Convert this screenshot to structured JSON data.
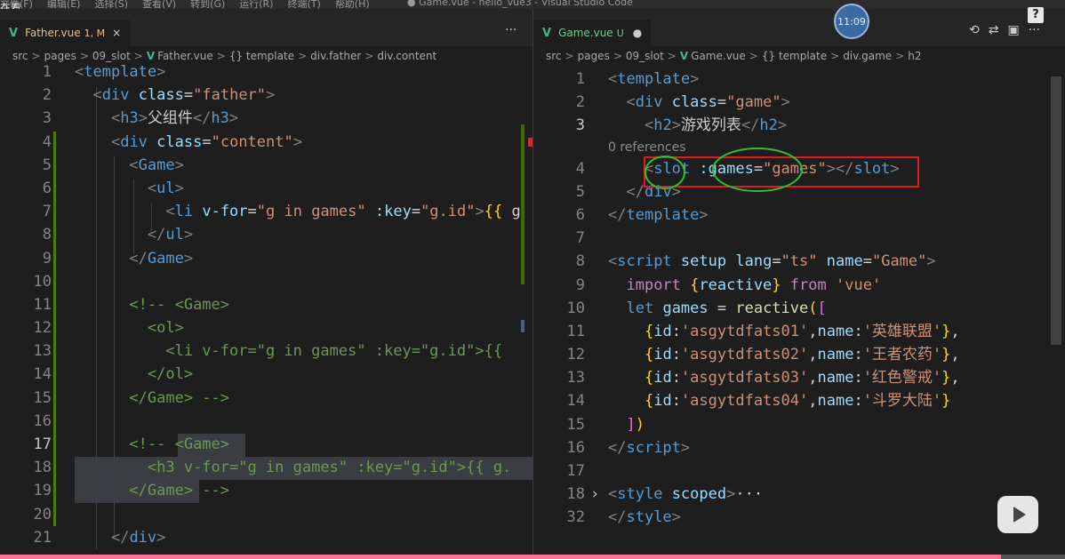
{
  "window": {
    "title": "● Game.vue - hello_vue3 - Visual Studio Code",
    "menu": [
      "文件(F)",
      "编辑(E)",
      "选择(S)",
      "查看(V)",
      "转到(G)",
      "运行(R)",
      "终端(T)",
      "帮助(H)"
    ],
    "overlay_text": "在看"
  },
  "left": {
    "tab": {
      "name": "Father.vue",
      "badge": "1, M",
      "close": "×",
      "more": "···"
    },
    "breadcrumb": [
      "src",
      "pages",
      "09_slot",
      "Father.vue",
      "{} template",
      "div.father",
      "div.content"
    ],
    "lines": [
      {
        "n": "1",
        "t": [
          [
            "tg",
            "<"
          ],
          [
            "tn",
            "template"
          ],
          [
            "tg",
            ">"
          ]
        ]
      },
      {
        "n": "2",
        "t": [
          [
            "pl",
            "  "
          ],
          [
            "tg",
            "<"
          ],
          [
            "tn",
            "div"
          ],
          [
            "pl",
            " "
          ],
          [
            "an",
            "class"
          ],
          [
            "pl",
            "="
          ],
          [
            "as",
            "\"father\""
          ],
          [
            "tg",
            ">"
          ]
        ]
      },
      {
        "n": "3",
        "t": [
          [
            "pl",
            "    "
          ],
          [
            "tg",
            "<"
          ],
          [
            "tn",
            "h3"
          ],
          [
            "tg",
            ">"
          ],
          [
            "ct",
            "父组件"
          ],
          [
            "tg",
            "</"
          ],
          [
            "tn",
            "h3"
          ],
          [
            "tg",
            ">"
          ]
        ]
      },
      {
        "n": "4",
        "t": [
          [
            "pl",
            "    "
          ],
          [
            "tg",
            "<"
          ],
          [
            "tn",
            "div"
          ],
          [
            "pl",
            " "
          ],
          [
            "an",
            "class"
          ],
          [
            "pl",
            "="
          ],
          [
            "as",
            "\"content\""
          ],
          [
            "tg",
            ">"
          ]
        ]
      },
      {
        "n": "5",
        "t": [
          [
            "pl",
            "      "
          ],
          [
            "tg",
            "<"
          ],
          [
            "tn",
            "Game"
          ],
          [
            "tg",
            ">"
          ]
        ]
      },
      {
        "n": "6",
        "t": [
          [
            "pl",
            "        "
          ],
          [
            "tg",
            "<"
          ],
          [
            "tn",
            "ul"
          ],
          [
            "tg",
            ">"
          ]
        ]
      },
      {
        "n": "7",
        "t": [
          [
            "pl",
            "          "
          ],
          [
            "tg",
            "<"
          ],
          [
            "tn",
            "li"
          ],
          [
            "pl",
            " "
          ],
          [
            "an",
            "v-for"
          ],
          [
            "pl",
            "="
          ],
          [
            "as",
            "\"g in games\""
          ],
          [
            "pl",
            " "
          ],
          [
            "an",
            ":key"
          ],
          [
            "pl",
            "="
          ],
          [
            "as",
            "\"g.id\""
          ],
          [
            "tg",
            ">"
          ],
          [
            "br",
            "{{"
          ],
          [
            "pl",
            " g"
          ]
        ]
      },
      {
        "n": "8",
        "t": [
          [
            "pl",
            "        "
          ],
          [
            "tg",
            "</"
          ],
          [
            "tn",
            "ul"
          ],
          [
            "tg",
            ">"
          ]
        ]
      },
      {
        "n": "9",
        "t": [
          [
            "pl",
            "      "
          ],
          [
            "tg",
            "</"
          ],
          [
            "tn",
            "Game"
          ],
          [
            "tg",
            ">"
          ]
        ]
      },
      {
        "n": "10",
        "t": []
      },
      {
        "n": "11",
        "t": [
          [
            "pl",
            "      "
          ],
          [
            "cm",
            "<!-- <Game>"
          ]
        ]
      },
      {
        "n": "12",
        "t": [
          [
            "pl",
            "        "
          ],
          [
            "cm",
            "<ol>"
          ]
        ]
      },
      {
        "n": "13",
        "t": [
          [
            "pl",
            "          "
          ],
          [
            "cm",
            "<li v-for=\"g in games\" :key=\"g.id\">{{"
          ]
        ]
      },
      {
        "n": "14",
        "t": [
          [
            "pl",
            "        "
          ],
          [
            "cm",
            "</ol>"
          ]
        ]
      },
      {
        "n": "15",
        "t": [
          [
            "pl",
            "      "
          ],
          [
            "cm",
            "</Game> -->"
          ]
        ]
      },
      {
        "n": "16",
        "t": []
      },
      {
        "n": "17",
        "t": [
          [
            "pl",
            "      "
          ],
          [
            "cm",
            "<!-- <Game>"
          ]
        ]
      },
      {
        "n": "18",
        "t": [
          [
            "pl",
            "        "
          ],
          [
            "cm",
            "<h3 v-for=\"g in games\" :key=\"g.id\">{{ g."
          ]
        ]
      },
      {
        "n": "19",
        "t": [
          [
            "pl",
            "      "
          ],
          [
            "cm",
            "</Game> -->"
          ]
        ]
      },
      {
        "n": "20",
        "t": []
      },
      {
        "n": "21",
        "t": [
          [
            "pl",
            "    "
          ],
          [
            "tg",
            "</"
          ],
          [
            "tn",
            "div"
          ],
          [
            "tg",
            ">"
          ]
        ]
      }
    ]
  },
  "right": {
    "tab": {
      "name": "Game.vue",
      "badge": "U",
      "dot": "●",
      "actions": [
        "⟲",
        "⇄",
        "▣",
        "···"
      ]
    },
    "breadcrumb": [
      "src",
      "pages",
      "09_slot",
      "Game.vue",
      "{} template",
      "div.game",
      "h2"
    ],
    "references_hint": "0 references",
    "lines": [
      {
        "n": "1",
        "t": [
          [
            "tg",
            "<"
          ],
          [
            "tn",
            "template"
          ],
          [
            "tg",
            ">"
          ]
        ]
      },
      {
        "n": "2",
        "t": [
          [
            "pl",
            "  "
          ],
          [
            "tg",
            "<"
          ],
          [
            "tn",
            "div"
          ],
          [
            "pl",
            " "
          ],
          [
            "an",
            "class"
          ],
          [
            "pl",
            "="
          ],
          [
            "as",
            "\"game\""
          ],
          [
            "tg",
            ">"
          ]
        ]
      },
      {
        "n": "3",
        "t": [
          [
            "pl",
            "    "
          ],
          [
            "tg",
            "<"
          ],
          [
            "tn",
            "h2"
          ],
          [
            "tg",
            ">"
          ],
          [
            "ct",
            "游戏列表"
          ],
          [
            "tg",
            "</"
          ],
          [
            "tn",
            "h2"
          ],
          [
            "tg",
            ">"
          ]
        ]
      },
      {
        "n": "4",
        "t": [
          [
            "pl",
            "    "
          ],
          [
            "tg",
            "<"
          ],
          [
            "tn",
            "slot"
          ],
          [
            "pl",
            " "
          ],
          [
            "an",
            ":games"
          ],
          [
            "pl",
            "="
          ],
          [
            "as",
            "\"games\""
          ],
          [
            "tg",
            "></"
          ],
          [
            "tn",
            "slot"
          ],
          [
            "tg",
            ">"
          ]
        ]
      },
      {
        "n": "5",
        "t": [
          [
            "pl",
            "  "
          ],
          [
            "tg",
            "</"
          ],
          [
            "tn",
            "div"
          ],
          [
            "tg",
            ">"
          ]
        ]
      },
      {
        "n": "6",
        "t": [
          [
            "tg",
            "</"
          ],
          [
            "tn",
            "template"
          ],
          [
            "tg",
            ">"
          ]
        ]
      },
      {
        "n": "7",
        "t": []
      },
      {
        "n": "8",
        "t": [
          [
            "tg",
            "<"
          ],
          [
            "tn",
            "script"
          ],
          [
            "pl",
            " "
          ],
          [
            "an",
            "setup"
          ],
          [
            "pl",
            " "
          ],
          [
            "an",
            "lang"
          ],
          [
            "pl",
            "="
          ],
          [
            "as",
            "\"ts\""
          ],
          [
            "pl",
            " "
          ],
          [
            "an",
            "name"
          ],
          [
            "pl",
            "="
          ],
          [
            "as",
            "\"Game\""
          ],
          [
            "tg",
            ">"
          ]
        ]
      },
      {
        "n": "9",
        "t": [
          [
            "pl",
            "  "
          ],
          [
            "kw",
            "import"
          ],
          [
            "pl",
            " "
          ],
          [
            "br",
            "{"
          ],
          [
            "vr",
            "reactive"
          ],
          [
            "br",
            "}"
          ],
          [
            "pl",
            " "
          ],
          [
            "kw",
            "from"
          ],
          [
            "pl",
            " "
          ],
          [
            "as",
            "'vue'"
          ]
        ]
      },
      {
        "n": "10",
        "t": [
          [
            "pl",
            "  "
          ],
          [
            "tn",
            "let"
          ],
          [
            "pl",
            " "
          ],
          [
            "vr",
            "games"
          ],
          [
            "pl",
            " = "
          ],
          [
            "fn",
            "reactive"
          ],
          [
            "br",
            "("
          ],
          [
            "br2",
            "["
          ]
        ]
      },
      {
        "n": "11",
        "t": [
          [
            "pl",
            "    "
          ],
          [
            "br",
            "{"
          ],
          [
            "vr",
            "id"
          ],
          [
            "pl",
            ":"
          ],
          [
            "as",
            "'asgytdfats01'"
          ],
          [
            "pl",
            ","
          ],
          [
            "vr",
            "name"
          ],
          [
            "pl",
            ":"
          ],
          [
            "as",
            "'英雄联盟'"
          ],
          [
            "br",
            "}"
          ],
          [
            "pl",
            ","
          ]
        ]
      },
      {
        "n": "12",
        "t": [
          [
            "pl",
            "    "
          ],
          [
            "br",
            "{"
          ],
          [
            "vr",
            "id"
          ],
          [
            "pl",
            ":"
          ],
          [
            "as",
            "'asgytdfats02'"
          ],
          [
            "pl",
            ","
          ],
          [
            "vr",
            "name"
          ],
          [
            "pl",
            ":"
          ],
          [
            "as",
            "'王者农药'"
          ],
          [
            "br",
            "}"
          ],
          [
            "pl",
            ","
          ]
        ]
      },
      {
        "n": "13",
        "t": [
          [
            "pl",
            "    "
          ],
          [
            "br",
            "{"
          ],
          [
            "vr",
            "id"
          ],
          [
            "pl",
            ":"
          ],
          [
            "as",
            "'asgytdfats03'"
          ],
          [
            "pl",
            ","
          ],
          [
            "vr",
            "name"
          ],
          [
            "pl",
            ":"
          ],
          [
            "as",
            "'红色警戒'"
          ],
          [
            "br",
            "}"
          ],
          [
            "pl",
            ","
          ]
        ]
      },
      {
        "n": "14",
        "t": [
          [
            "pl",
            "    "
          ],
          [
            "br",
            "{"
          ],
          [
            "vr",
            "id"
          ],
          [
            "pl",
            ":"
          ],
          [
            "as",
            "'asgytdfats04'"
          ],
          [
            "pl",
            ","
          ],
          [
            "vr",
            "name"
          ],
          [
            "pl",
            ":"
          ],
          [
            "as",
            "'斗罗大陆'"
          ],
          [
            "br",
            "}"
          ]
        ]
      },
      {
        "n": "15",
        "t": [
          [
            "pl",
            "  "
          ],
          [
            "br2",
            "]"
          ],
          [
            "br",
            ")"
          ]
        ]
      },
      {
        "n": "16",
        "t": [
          [
            "tg",
            "</"
          ],
          [
            "tn",
            "script"
          ],
          [
            "tg",
            ">"
          ]
        ]
      },
      {
        "n": "17",
        "t": []
      },
      {
        "n": "18",
        "fold": "›",
        "t": [
          [
            "tg",
            "<"
          ],
          [
            "tn",
            "style"
          ],
          [
            "pl",
            " "
          ],
          [
            "an",
            "scoped"
          ],
          [
            "tg",
            ">"
          ],
          [
            "pl",
            "···"
          ]
        ]
      },
      {
        "n": "32",
        "t": [
          [
            "tg",
            "</"
          ],
          [
            "tn",
            "style"
          ],
          [
            "tg",
            ">"
          ]
        ]
      }
    ]
  },
  "overlays": {
    "clock_text": "11:09",
    "help_label": "?",
    "video_progress": 0.94
  }
}
